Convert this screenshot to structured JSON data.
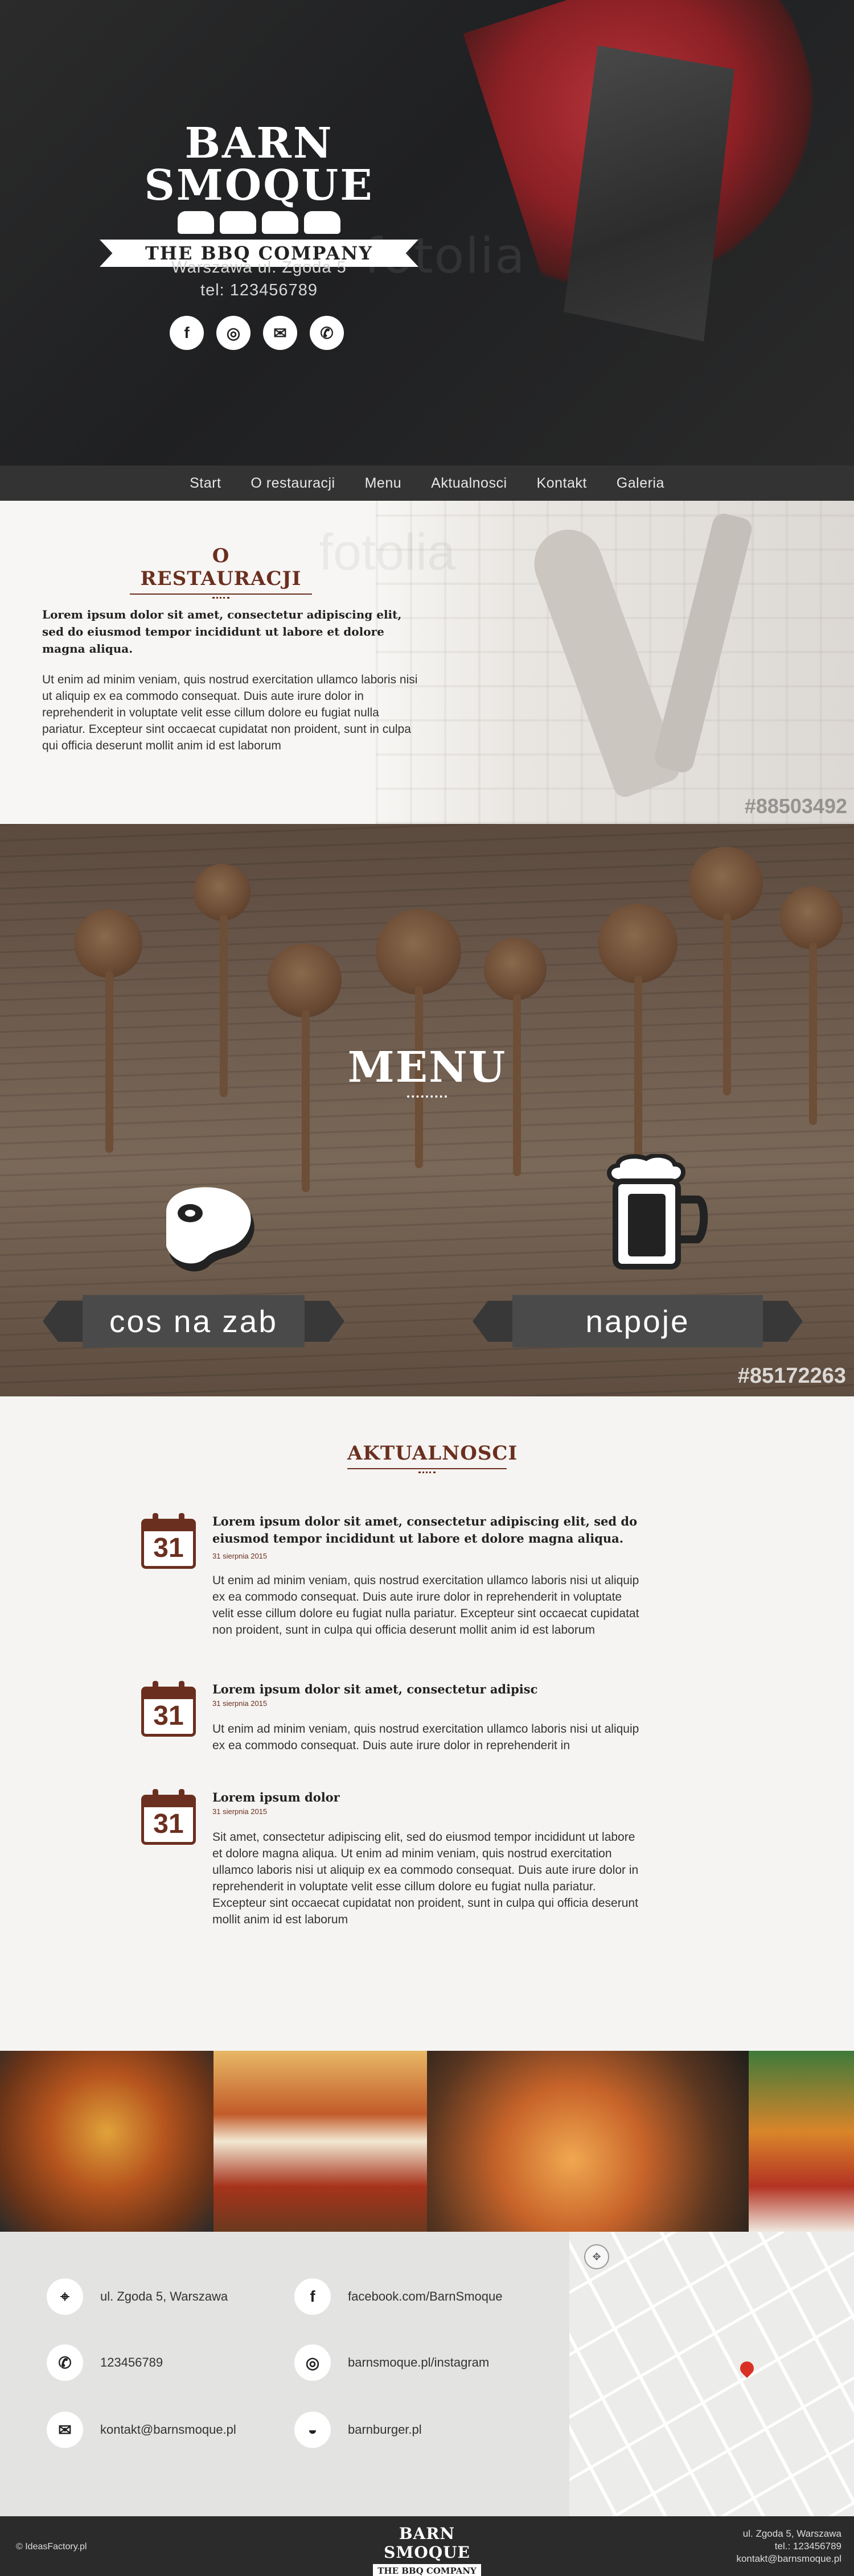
{
  "hero": {
    "logo_title": "BARN SMOQUE",
    "logo_subtitle": "THE BBQ COMPANY",
    "address_line": "Warszawa ul. Zgoda 5",
    "phone_line": "tel: 123456789",
    "watermark": "fotolia",
    "socials": [
      {
        "icon": "facebook-icon",
        "glyph": "f"
      },
      {
        "icon": "instagram-icon",
        "glyph": "◎"
      },
      {
        "icon": "mail-icon",
        "glyph": "✉"
      },
      {
        "icon": "phone-icon",
        "glyph": "✆"
      }
    ]
  },
  "nav": {
    "items": [
      "Start",
      "O restauracji",
      "Menu",
      "Aktualnosci",
      "Kontakt",
      "Galeria"
    ]
  },
  "about": {
    "heading": "O RESTAURACJI",
    "lead": "Lorem ipsum dolor sit amet, consectetur adipiscing elit, sed do eiusmod tempor incididunt ut labore et dolore magna aliqua.",
    "body": "Ut enim ad minim veniam, quis nostrud exercitation ullamco laboris nisi ut aliquip ex ea commodo consequat. Duis aute irure dolor in reprehenderit in voluptate velit esse cillum dolore eu fugiat nulla pariatur. Excepteur sint occaecat cupidatat non proident, sunt in culpa qui officia deserunt mollit anim id est laborum",
    "photo_id": "#88503492",
    "watermark": "fotolia"
  },
  "menu": {
    "title": "MENU",
    "food_label": "cos na zab",
    "drinks_label": "napoje",
    "photo_id": "#85172263"
  },
  "news": {
    "heading": "AKTUALNOSCI",
    "items": [
      {
        "day": "31",
        "title": "Lorem ipsum dolor sit amet, consectetur adipiscing elit, sed do eiusmod tempor incididunt ut labore et dolore magna aliqua.",
        "date": "31 sierpnia 2015",
        "body": "Ut enim ad minim veniam, quis nostrud exercitation ullamco laboris nisi ut aliquip ex ea commodo consequat. Duis aute irure dolor in reprehenderit in voluptate velit esse cillum dolore eu fugiat nulla pariatur. Excepteur sint occaecat cupidatat non proident, sunt in culpa qui officia deserunt mollit anim id est laborum"
      },
      {
        "day": "31",
        "title": "Lorem ipsum dolor sit amet, consectetur adipisc",
        "date": "31 sierpnia 2015",
        "body": "Ut enim ad minim veniam, quis nostrud exercitation ullamco laboris nisi ut aliquip ex ea commodo consequat. Duis aute irure dolor in reprehenderit in"
      },
      {
        "day": "31",
        "title": "Lorem ipsum dolor",
        "date": "31 sierpnia 2015",
        "body": "Sit amet, consectetur adipiscing elit, sed do eiusmod tempor incididunt ut labore et dolore magna aliqua. Ut enim ad minim veniam, quis nostrud exercitation ullamco laboris nisi ut aliquip ex ea commodo consequat. Duis aute irure dolor in reprehenderit in voluptate velit esse cillum dolore eu fugiat nulla pariatur. Excepteur sint occaecat cupidatat non proident, sunt in culpa qui officia deserunt mollit anim id est laborum"
      }
    ]
  },
  "contact": {
    "address": "ul. Zgoda 5, Warszawa",
    "facebook": "facebook.com/BarnSmoque",
    "phone": "123456789",
    "instagram": "barnsmoque.pl/instagram",
    "email": "kontakt@barnsmoque.pl",
    "burger": "barnburger.pl"
  },
  "footer": {
    "copyright": "© IdeasFactory.pl",
    "logo_title": "BARN SMOQUE",
    "logo_subtitle": "THE BBQ COMPANY",
    "addr1": "ul. Zgoda 5, Warszawa",
    "addr2": "tel.: 123456789",
    "addr3": "kontakt@barnsmoque.pl"
  },
  "colors": {
    "accent_brown": "#6b2f1f",
    "nav_bg": "#333333",
    "ribbon": "#4a4a4a"
  }
}
